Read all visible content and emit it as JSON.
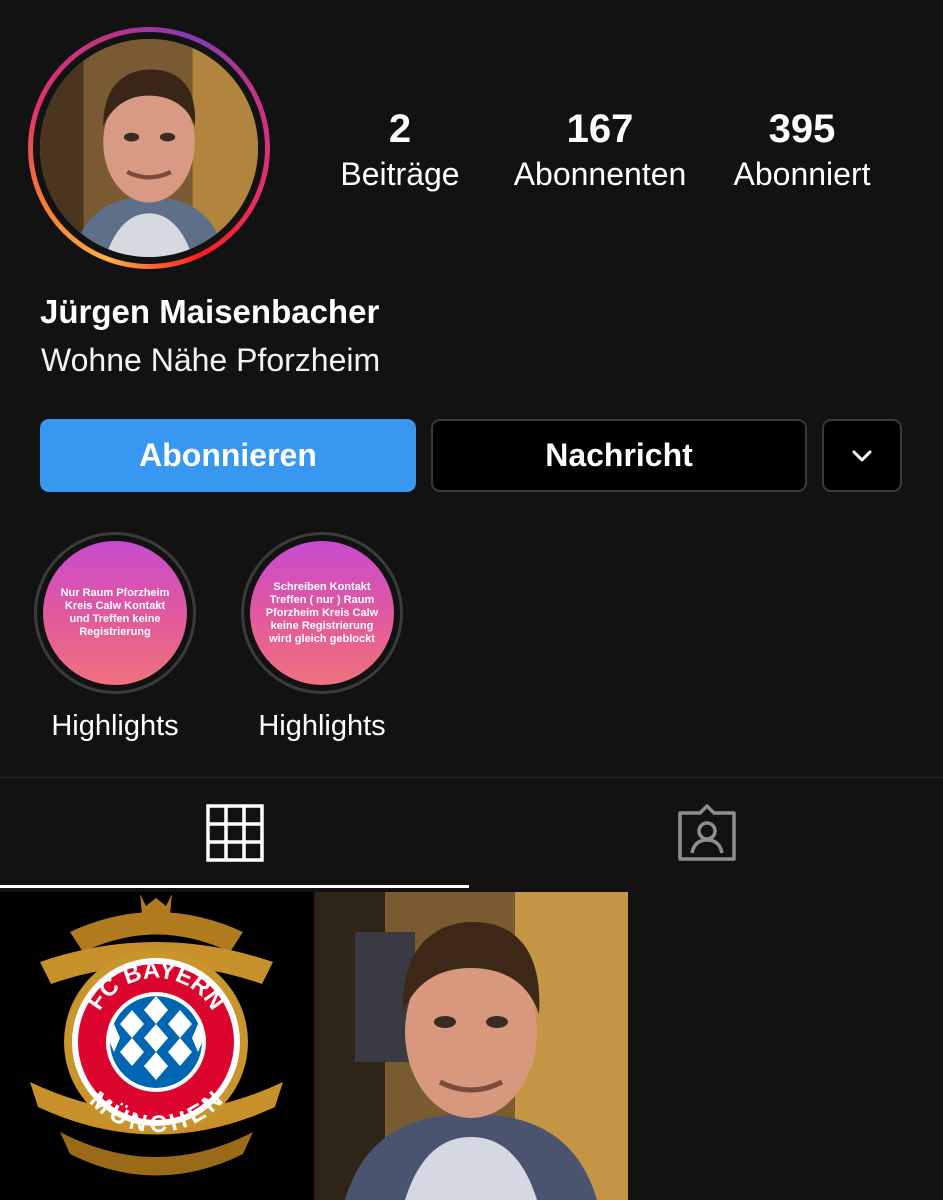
{
  "profile": {
    "name": "Jürgen Maisenbacher",
    "bio": "Wohne Nähe Pforzheim",
    "avatar_icon": "profile-photo"
  },
  "stats": {
    "posts": {
      "value": "2",
      "label": "Beiträge"
    },
    "followers": {
      "value": "167",
      "label": "Abonnenten"
    },
    "following": {
      "value": "395",
      "label": "Abonniert"
    }
  },
  "actions": {
    "follow_label": "Abonnieren",
    "message_label": "Nachricht",
    "more_icon": "chevron-down-icon"
  },
  "highlights": [
    {
      "cover_text": "Nur Raum Pforzheim Kreis Calw Kontakt und Treffen keine Registrierung",
      "label": "Highlights"
    },
    {
      "cover_text": "Schreiben Kontakt Treffen ( nur ) Raum Pforzheim Kreis Calw keine Registrierung wird gleich geblockt",
      "label": "Highlights"
    }
  ],
  "tabs": [
    {
      "icon": "grid-icon",
      "active": true
    },
    {
      "icon": "tagged-person-icon",
      "active": false
    }
  ],
  "posts": [
    {
      "logo_text_top": "FC BAYERN",
      "logo_text_bottom": "MÜNCHEN"
    },
    {
      "icon": "portrait-photo"
    }
  ],
  "colors": {
    "background": "#121212",
    "accent": "#3897f0",
    "highlight_gradient_top": "#c84bd0",
    "highlight_gradient_bottom": "#f0727e"
  }
}
